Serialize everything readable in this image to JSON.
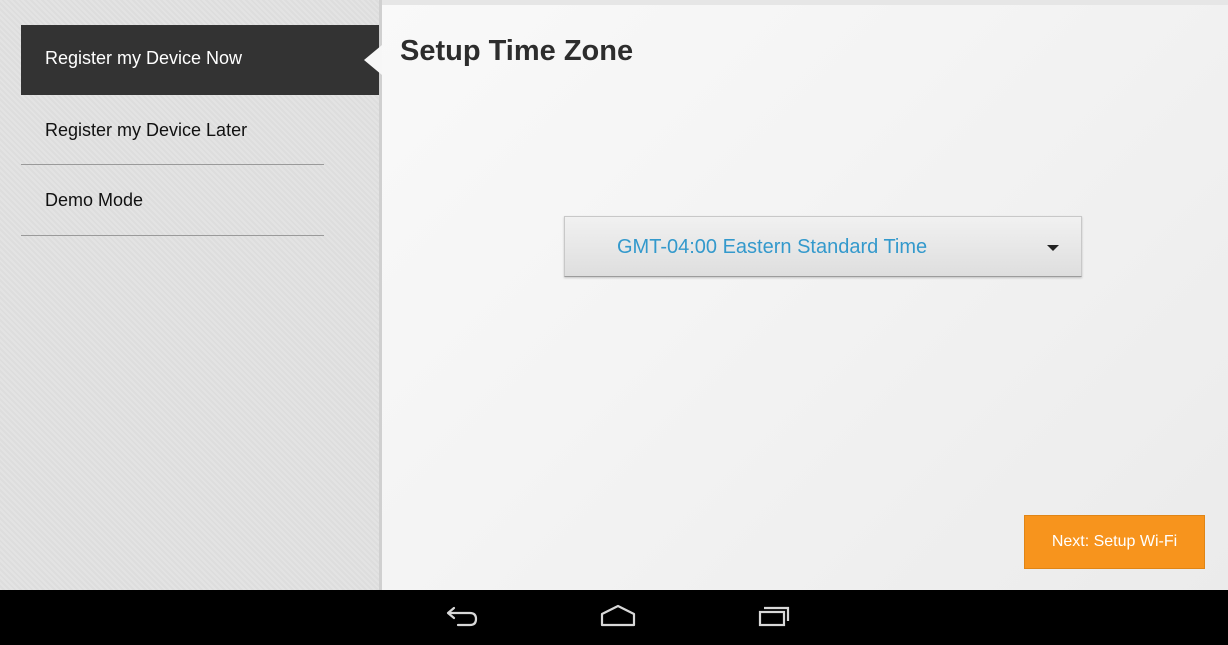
{
  "sidebar": {
    "items": [
      {
        "label": "Register my Device Now",
        "active": true
      },
      {
        "label": "Register my Device Later",
        "active": false
      },
      {
        "label": "Demo Mode",
        "active": false
      }
    ]
  },
  "main": {
    "title": "Setup Time Zone",
    "timezone_select": {
      "value": "GMT-04:00 Eastern Standard Time",
      "icon": "caret-down-icon"
    },
    "next_button_label": "Next: Setup Wi-Fi"
  },
  "navbar": {
    "buttons": [
      {
        "name": "back-icon"
      },
      {
        "name": "home-icon"
      },
      {
        "name": "recent-apps-icon"
      }
    ]
  },
  "colors": {
    "accent": "#f7941d",
    "selected_value": "#3399cc",
    "active_item_bg": "#333333"
  }
}
